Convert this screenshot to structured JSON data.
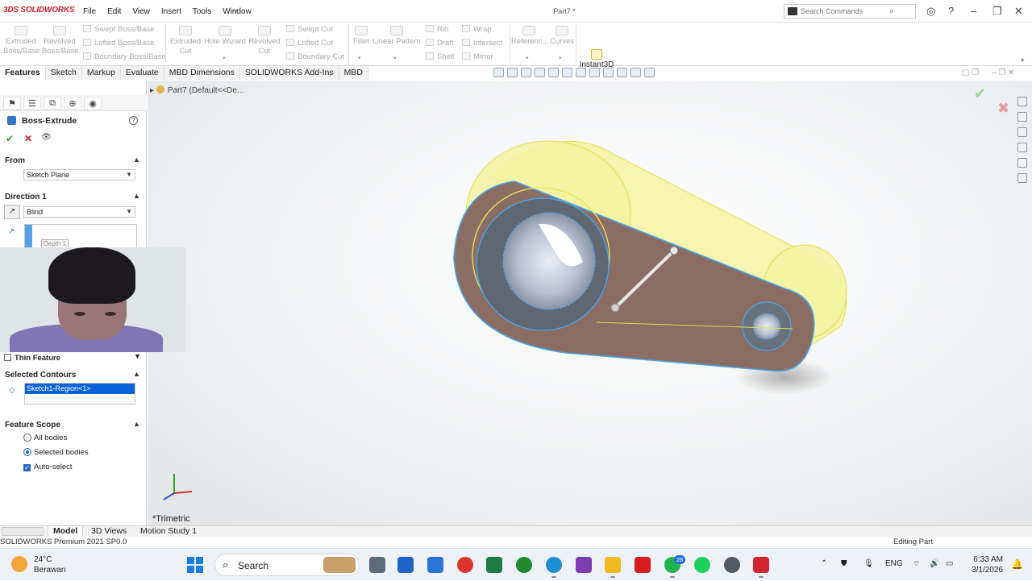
{
  "app": {
    "logo": "3DS SOLIDWORKS",
    "doc_title": "Part7 *"
  },
  "menu": [
    "File",
    "Edit",
    "View",
    "Insert",
    "Tools",
    "Window"
  ],
  "search": {
    "placeholder": "Search Commands"
  },
  "command_manager": {
    "extruded_boss": "Extruded Boss/Base",
    "revolved_boss": "Revolved Boss/Base",
    "swept_boss": "Swept Boss/Base",
    "lofted_boss": "Lofted Boss/Base",
    "boundary_boss": "Boundary Boss/Base",
    "extruded_cut": "Extruded Cut",
    "hole_wizard": "Hole Wizard",
    "revolved_cut": "Revolved Cut",
    "swept_cut": "Swept Cut",
    "lofted_cut": "Lofted Cut",
    "boundary_cut": "Boundary Cut",
    "fillet": "Fillet",
    "linear_pattern": "Linear Pattern",
    "rib": "Rib",
    "draft": "Draft",
    "shell": "Shell",
    "wrap": "Wrap",
    "intersect": "Intersect",
    "mirror": "Mirror",
    "reference": "Referenc...",
    "curves": "Curves",
    "instant3d": "Instant3D"
  },
  "tabs": [
    "Features",
    "Sketch",
    "Markup",
    "Evaluate",
    "MBD Dimensions",
    "SOLIDWORKS Add-Ins",
    "MBD"
  ],
  "property_manager": {
    "title": "Boss-Extrude",
    "from": {
      "header": "From",
      "value": "Sketch Plane"
    },
    "direction1": {
      "header": "Direction 1",
      "value": "Blind",
      "depth_label": "Depth 1"
    },
    "thin_feature": "Thin Feature",
    "selected_contours": {
      "header": "Selected Contours",
      "value": "Sketch1-Region<1>"
    },
    "feature_scope": {
      "header": "Feature Scope",
      "all_bodies": "All bodies",
      "selected_bodies": "Selected bodies",
      "auto_select": "Auto-select"
    }
  },
  "viewport": {
    "tree_label": "Part7  (Default<<De...",
    "view_name": "*Trimetric"
  },
  "bottom_tabs": [
    "Model",
    "3D Views",
    "Motion Study 1"
  ],
  "status": {
    "left": "SOLIDWORKS Premium 2021 SP0.0",
    "right": "Editing Part"
  },
  "taskbar": {
    "temp": "24°C",
    "weather": "Berawan",
    "search": "Search",
    "badge": "28",
    "lang": "ENG",
    "time": "6:33 AM",
    "date": "3/1/2026"
  },
  "colors": {
    "accent": "#0b61d6",
    "model_body": "#8c6f66",
    "preview": "#f4f4a8",
    "edge": "#4aa3e8"
  }
}
